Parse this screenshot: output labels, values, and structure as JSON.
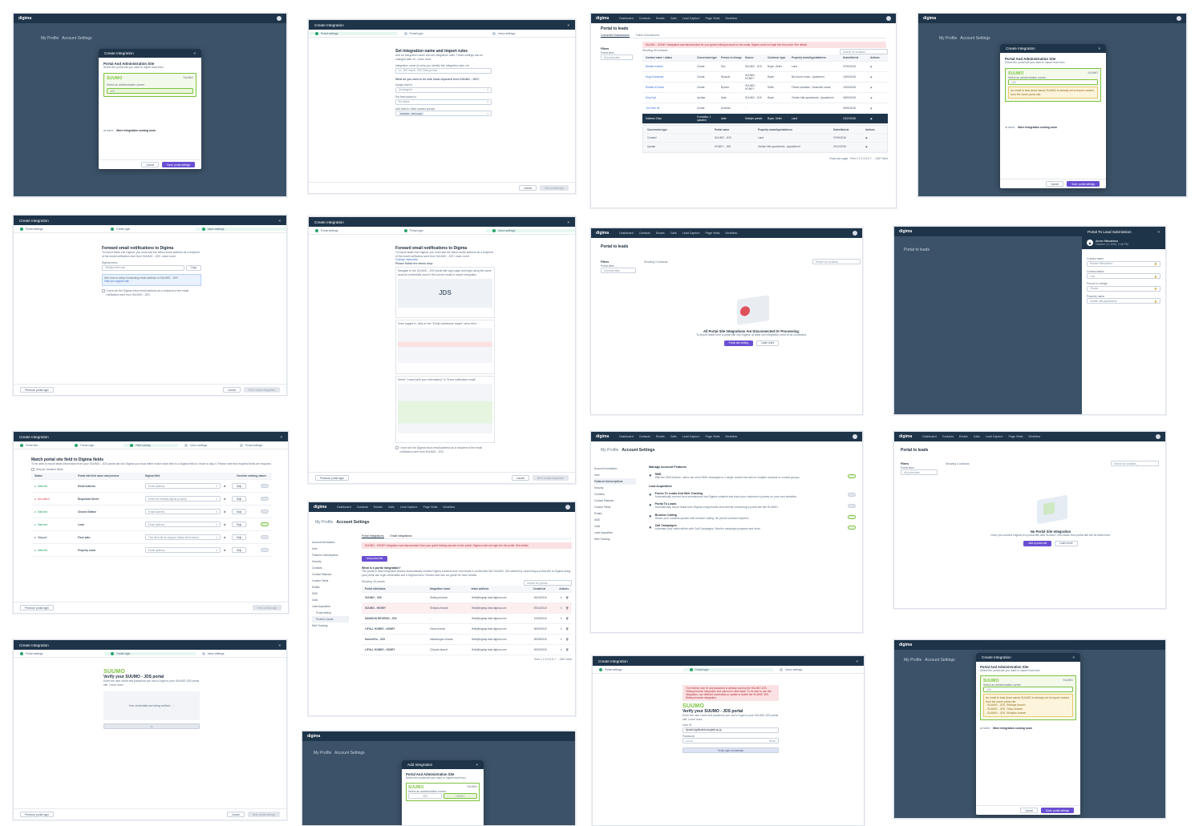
{
  "brand": {
    "logo": "digima",
    "nav": [
      "Dashboard",
      "Contacts",
      "Emails",
      "Calls",
      "Lead Capture",
      "Page Visits",
      "Workflow"
    ]
  },
  "colors": {
    "navy": "#1e3449",
    "purple": "#6a4fd3",
    "green": "#27a36b",
    "alert_bg": "#fbe1e3"
  },
  "common": {
    "create_integration": "Create Integration",
    "add_integration": "Add Integration",
    "close_icon": "×",
    "cancel": "Cancel",
    "previous": "Previous: portal login",
    "steps": [
      "Portal settings",
      "Portal login",
      "Inbox settings"
    ],
    "steps5": [
      "Portal site",
      "Portal login",
      "Field routing",
      "Inbox settings",
      "Portal settings"
    ]
  },
  "portal_admin": {
    "title": "Portal And Administration Site",
    "subtitle": "Select the portal site you want to import lead from.",
    "learn_more": "Learn more",
    "suumo": "SUUMO",
    "suumo_tag": "SUUMO",
    "select_admin": "Select an administration screen",
    "jds": "JDS",
    "honey": "HONEY",
    "athome": "at home",
    "coming_soon": "More integration coming soon",
    "save": "Save: portal settings",
    "warning": "An email to lead (lead name) SUUMO is already set to import contact from the same portal site.",
    "warning_list": "- SUUMO - JDS. Shibuya branch\n- SUUMO - JDS. Tokyo branch\n- SUUMO - JDS. Shinjuku branch"
  },
  "set_rules": {
    "title": "Set integration name and import rules",
    "intro": "Add an integration name and set integration rules. These settings can be changed later on. Learn more.",
    "name_label": "Integration name (to help you identify this integration later on)",
    "name_placeholder": "ex. JDS Import, JDS Shibuya lead",
    "what_do": "What do you want to do with leads imported from SUUMO - JDS?",
    "assign": "Assign lead to",
    "assign_val": "Unassigned",
    "status": "Set lead status to",
    "status_val": "No status",
    "groups": "Add lead to Gidia contact groups",
    "group_tag": "SUUMO - JDS leads",
    "next": "Next: portal login"
  },
  "forward": {
    "title": "Forward email notifications to Digima",
    "intro": "To import leads into Digima, you must add the below email address as a recipient of the email notification sent from SUUMO - JDS. Learn more.",
    "inbox_label": "Digima inbox",
    "inbox_val": "info@portnet.com",
    "copy": "Copy",
    "info": "See how to setup forwarding email address in SUUMO - JDS",
    "info2": "Visit our support site",
    "confirm": "I have set the Digima inbox email address as a recipient of the email notification sent from SUUMO - JDS.",
    "create": "Next: create integration",
    "change": "Change instruction",
    "follow": "Please follow the below step:",
    "step1": "Navigate to the SUUMO - JDS portal site login page and login using the same account credentials used in the current email to import integration.",
    "step2": "Once logged in, click on the \"Email submission target\" menu item.",
    "step3": "Select \"I want (with your information)\" in \"Extra notification email\".",
    "logo_jds": "JDS"
  },
  "portal_to_leads": {
    "title": "Portal to leads",
    "tab1": "Converted Submissions",
    "tab2": "Failed Submissions",
    "alert": "SUUMO - HONEY integration was disconnected for your guest holding account on the portal. Digima could not login into the portal. See details",
    "filters": "Filters",
    "portal_sites": "Portal sites",
    "all_sites": "All portal sites",
    "showing": "Showing 50 contacts",
    "search": "Search for contacts...",
    "cols": [
      "Contact name / status",
      "Conversion type",
      "Person in charge",
      "Source",
      "Customer type",
      "Property name/type/address",
      "Submitted at",
      "Actions"
    ],
    "rows": [
      [
        "Noelani Kuboki",
        "Create",
        "Ryu",
        "SUUMO - JDS",
        "Buyer, Seller",
        "Land",
        "07/06/2018"
      ],
      [
        "Hugo Kuramoto",
        "Create",
        "Ryosuki",
        "SUUMO - HONEY",
        "Buyer",
        "Bel Azure condo - Apartment",
        "13/05/2018"
      ],
      [
        "Rohisto El Noori",
        "Create",
        "Byrnes",
        "SUUMO - HONEY",
        "Seller",
        "Flower paradise - Detached house",
        "12/05/2018"
      ],
      [
        "Emy Nori",
        "Update",
        "Akim",
        "SUUMO - JDS",
        "Buyer",
        "Golden hills apartments - Appartment",
        "26/09/2018"
      ],
      [
        "Yui Chen Ito",
        "Create",
        "Andreas",
        "-",
        "-",
        "-",
        "09/06/2018"
      ],
      [
        "Hakeem Zhao",
        "5 creation, 1 updated",
        "Akim",
        "Multiple portals",
        "Buyer, Seller",
        "Land",
        "13/12/2018"
      ]
    ],
    "sub_cols": [
      "Conversion type",
      "Portal name",
      "Property name/type/address",
      "Submitted at",
      "Actions"
    ],
    "sub_rows": [
      [
        "Created",
        "SUUMO - JDS",
        "Land",
        "07/06/2018"
      ],
      [
        "Update",
        "HONEY - JDS",
        "Golden hills apartments - Appartment",
        "03/12/2018"
      ]
    ],
    "pager": "Prev 1 2 3 4 5 6 7 ... 1367 Next",
    "rows_per_page": "Rows per page",
    "empty_contacts": "Showing 0 contacts",
    "disconnected_title": "All Portal Site Integrations Are Disconnected Or Processing.",
    "disconnected_text": "To import leads from a portal site into Digima, at least one integration need to be connected.",
    "portal_settings": "Portal site setting",
    "learn_more_btn": "Learn more",
    "no_integration_title": "No Portal Site Integration",
    "no_integration_text": "Once you connect Digima to a portal site with SUUMO, new leads from portal site will be listed here.",
    "add_portal": "Add a portal site"
  },
  "submission": {
    "title": "Portal To Lead Submission",
    "name": "Annan Mitsushima",
    "date": "October 12, 2020, 2:46 PM",
    "fields": [
      "Contact name",
      "Contact status",
      "Person in charge",
      "Property name"
    ],
    "values": [
      "Richard Mitsushima",
      "Lost",
      "Otsuka",
      "Golden hills apartments"
    ]
  },
  "match": {
    "title": "Match portal site field to Digima fields",
    "intro": "To be able to import leads information from your SUUMO - JDS portal site into Digima you must either match each field to a Digima field or chose to skip it. Please note that required fields are required.",
    "skip_all": "Skip all unmatch fields",
    "cols": [
      "Status",
      "Portal site field name and preview",
      "Digima field",
      "Override existing values"
    ],
    "rows": [
      [
        "Matched",
        "Email Address",
        "Email address"
      ],
      [
        "Not match",
        "Requested Street",
        "Select an existing digima property"
      ],
      [
        "Matched",
        "Closest Station",
        "Email address"
      ],
      [
        "Matched",
        "Land",
        "Email address"
      ],
      [
        "Skipped",
        "Floor plan",
        "This field will be skipped. Match field instead"
      ],
      [
        "Matched",
        "Property name",
        "Email address"
      ]
    ],
    "skip": "Skip",
    "next": "Next: portal login"
  },
  "verify": {
    "title": "Verify your SUUMO - JDS portal",
    "intro": "Enter the user name and password you use to login to your SUUMO JDS portal site. Learn more.",
    "verifying": "Your credentials are being verified...",
    "error": "The entered user ID and password is already used by the SUUMO JDS. Shibuya branch integration and cannot be used twice. To be able to use this integration, use different credentials or update or delete the SUUMO JDS. Shibuya branch integration.",
    "userid": "User ID",
    "userid_val": "kiyoshi.kg@shinta-kogteki.ac.jp",
    "password": "Password",
    "show": "Show",
    "verify_btn": "Verify login credentials",
    "next": "Next: portal settings"
  },
  "account": {
    "my_profile": "My Profile",
    "title": "Account Settings",
    "side": [
      "Account Information",
      "User",
      "Features Subscriptions",
      "Security",
      "Contacts",
      "Contact Statuses",
      "Custom Fields",
      "Emails",
      "SMS",
      "Calls",
      "Lead Acquisition",
      "Web Tracking"
    ],
    "side_sub": [
      "Portal setting",
      "Portal to Leads"
    ],
    "features_title": "Manage Account Features",
    "features": [
      [
        "SMS",
        "With the SMS feature, users can send SMS messages to a single contact but also to multiple contacts or contact groups.",
        true
      ],
      [
        "Forms To Leads And Web Tracking",
        "Automatically convert form submissions into Digima contacts and track your customer's journey on your own websites.",
        false
      ],
      [
        "Portal To Leads",
        "Automatically import leads from Digima using emails sent directly connecting a portal site like SUUMO.",
        false
      ],
      [
        "Browser Calling",
        "Reach your contacts quicker with browser calling. No phone contract required.",
        true
      ],
      [
        "Call Campaigns",
        "Automate your sales efforts with Call Campaigns. Monitor campaign progress and more.",
        true
      ]
    ],
    "lead_acq": "Lead Acquisition",
    "tabs": [
      "Portal Integrations",
      "Email Integrations"
    ],
    "alert": "SUUMO - HONEY integration was disconnected from your guest holding account on the portal. Digima could not login into the portal. See details",
    "what_is": "What is a portal integration?",
    "what_text": "The portal to lead integration feature automatically creates Digima contacts from new leads in portal sites like SUUMO. Get started by connecting a portal site to Digima using your portal site login credentials and a Digima inbox. Review and see our guide for more details.",
    "add_portal": "Add portal site",
    "showing": "Showing 16 portals",
    "search": "Search for portals...",
    "cols": [
      "Portal site/status",
      "Integration name",
      "Inbox address",
      "Created at",
      "Actions"
    ],
    "rows": [
      [
        "SUUMO - JDS",
        "Shibuya branch",
        "ffeid@ingtrap.lead.digima.com",
        "09/16/2018"
      ],
      [
        "SUUMO - HONEY",
        "Shinjuku branch",
        "ffeid@ingtrap.lead.digima.com",
        "09/16/2018"
      ],
      [
        "MANSION REVIEWS - JDS",
        "-",
        "ffeid@ingtrap.lead.digima.com",
        "12/05/2018"
      ],
      [
        "LIFULL HOMES - HONEY",
        "Ginza branch",
        "ffeid@ingtrap.lead.digima.com",
        "06/09/2018"
      ],
      [
        "HomesPro - JDS",
        "Nakameguro branch",
        "ffeid@ingtrap.lead.digima.com",
        "08/08/2018"
      ],
      [
        "LIFULL HOMES - HONEY",
        "Chiyoda branch",
        "ffeid@ingtrap.lead.digima.com",
        "06/09/2018"
      ]
    ]
  }
}
